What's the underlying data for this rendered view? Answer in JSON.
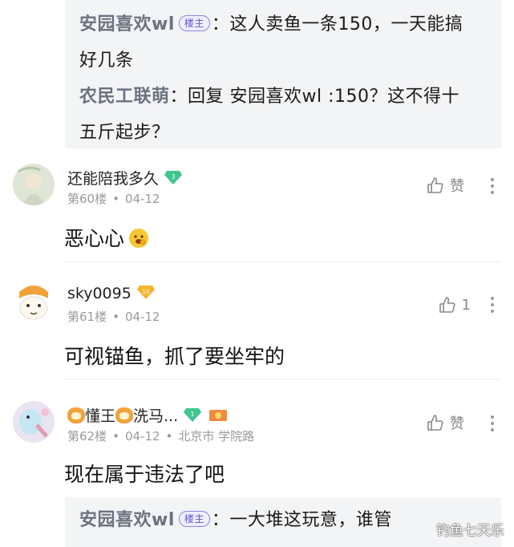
{
  "thread_top": {
    "reply1_user": "安园喜欢wl",
    "reply1_text": "：这人卖鱼一条150，一天能搞",
    "reply1_text_cont": "好几条",
    "reply2_user": "农民工联萌",
    "reply2_text": "：回复 安园喜欢wl :150？这不得十",
    "reply2_text_cont": "五斤起步？",
    "op_badge": "楼主"
  },
  "comments": [
    {
      "username": "还能陪我多久",
      "level": "3",
      "floor": "第60楼",
      "date": "04-12",
      "text": "恶心心",
      "like_label": "赞"
    },
    {
      "username": "sky0095",
      "level": "10",
      "floor": "第61楼",
      "date": "04-12",
      "text": "可视锚鱼，抓了要坐牢的",
      "like_count": "1"
    },
    {
      "username": "懂王",
      "username_suffix": "洗马...",
      "level": "1",
      "floor": "第62楼",
      "date": "04-12",
      "location": "北京市 学院路",
      "text": "现在属于违法了吧",
      "like_label": "赞"
    }
  ],
  "thread_bottom": {
    "reply_user": "安园喜欢wl",
    "op_badge": "楼主",
    "reply_text": "：一大堆这玩意，谁管"
  },
  "separator_dot": "•",
  "watermark": "钓鱼七天乐",
  "colors": {
    "badge_green": "#3fc58e",
    "badge_gold": "#f6b42d",
    "accent_purple": "#5a58c8"
  }
}
